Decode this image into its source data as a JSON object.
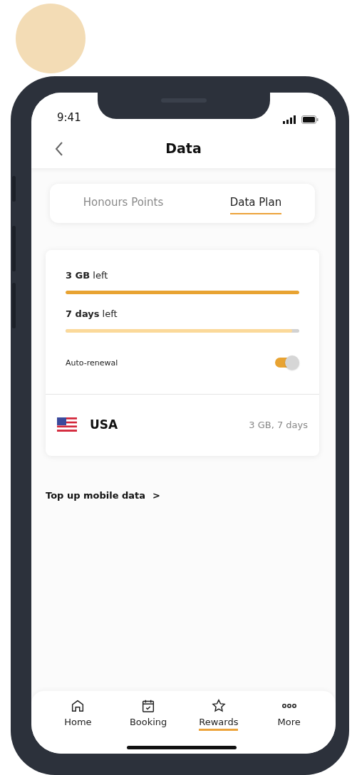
{
  "status_bar": {
    "time": "9:41"
  },
  "header": {
    "title": "Data"
  },
  "tabs": [
    {
      "label": "Honours Points",
      "selected": false
    },
    {
      "label": "Data Plan",
      "selected": true
    }
  ],
  "usage": [
    {
      "text": "**3 GB** left",
      "kind": "primary",
      "level": 1
    },
    {
      "text": "**7 days** left",
      "kind": "secondary",
      "level": 0.97
    }
  ],
  "auto_renewal": {
    "label": "Auto-renewal",
    "on": true
  },
  "plan": {
    "country": "USA",
    "details": "3 GB, 7 days"
  },
  "top_up_link": {
    "label": "Top up mobile data",
    "arrow": ">"
  },
  "bottom_nav": [
    {
      "label": "Home",
      "selected": false
    },
    {
      "label": "Booking",
      "selected": false
    },
    {
      "label": "Rewards",
      "selected": true
    },
    {
      "label": "More",
      "selected": false
    }
  ]
}
